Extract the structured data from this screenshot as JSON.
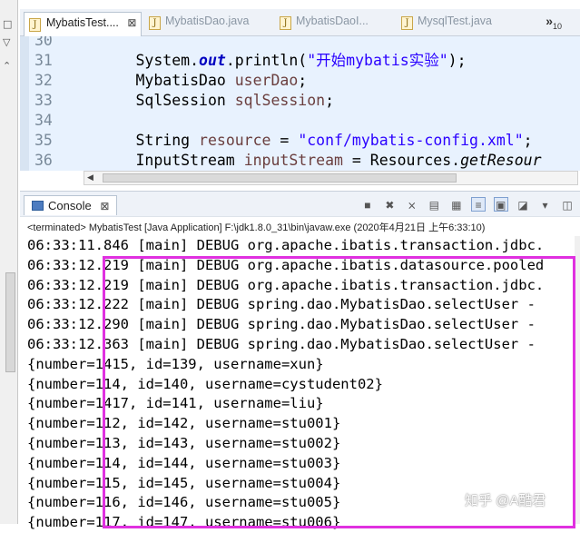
{
  "editor": {
    "tabs": [
      {
        "label": "MybatisTest....",
        "active": true
      },
      {
        "label": "MybatisDao.java",
        "active": false
      },
      {
        "label": "MybatisDaoI...",
        "active": false
      },
      {
        "label": "MysqlTest.java",
        "active": false
      }
    ],
    "tab_close": "⊠",
    "overflow_label": "»",
    "overflow_count": "10",
    "lines": [
      {
        "num": "30",
        "parts": []
      },
      {
        "num": "31",
        "parts": [
          {
            "t": "        System.",
            "c": ""
          },
          {
            "t": "out",
            "c": "fld"
          },
          {
            "t": ".println(",
            "c": ""
          },
          {
            "t": "\"开始mybatis实验\"",
            "c": "str"
          },
          {
            "t": ");",
            "c": ""
          }
        ]
      },
      {
        "num": "32",
        "parts": [
          {
            "t": "        MybatisDao ",
            "c": ""
          },
          {
            "t": "userDao",
            "c": "var"
          },
          {
            "t": ";",
            "c": ""
          }
        ]
      },
      {
        "num": "33",
        "parts": [
          {
            "t": "        SqlSession ",
            "c": ""
          },
          {
            "t": "sqlSession",
            "c": "var"
          },
          {
            "t": ";",
            "c": ""
          }
        ]
      },
      {
        "num": "34",
        "parts": []
      },
      {
        "num": "35",
        "parts": [
          {
            "t": "        String ",
            "c": ""
          },
          {
            "t": "resource",
            "c": "var"
          },
          {
            "t": " = ",
            "c": ""
          },
          {
            "t": "\"conf/mybatis-config.xml\"",
            "c": "str"
          },
          {
            "t": ";",
            "c": ""
          }
        ]
      },
      {
        "num": "36",
        "parts": [
          {
            "t": "        InputStream ",
            "c": ""
          },
          {
            "t": "inputStream",
            "c": "var"
          },
          {
            "t": " = Resources.",
            "c": ""
          },
          {
            "t": "getResour",
            "c": "mth"
          }
        ]
      }
    ]
  },
  "console": {
    "title": "Console",
    "close": "⊠",
    "status": "<terminated> MybatisTest [Java Application] F:\\jdk1.8.0_31\\bin\\javaw.exe (2020年4月21日 上午6:33:10)",
    "output": [
      "06:33:11.846 [main] DEBUG org.apache.ibatis.transaction.jdbc.",
      "06:33:12.219 [main] DEBUG org.apache.ibatis.datasource.pooled",
      "06:33:12.219 [main] DEBUG org.apache.ibatis.transaction.jdbc.",
      "06:33:12.222 [main] DEBUG spring.dao.MybatisDao.selectUser -",
      "06:33:12.290 [main] DEBUG spring.dao.MybatisDao.selectUser -",
      "06:33:12.363 [main] DEBUG spring.dao.MybatisDao.selectUser -",
      "{number=1415, id=139, username=xun}",
      "{number=114, id=140, username=cystudent02}",
      "{number=1417, id=141, username=liu}",
      "{number=112, id=142, username=stu001}",
      "{number=113, id=143, username=stu002}",
      "{number=114, id=144, username=stu003}",
      "{number=115, id=145, username=stu004}",
      "{number=116, id=146, username=stu005}",
      "{number=117, id=147, username=stu006}"
    ]
  },
  "watermark": "知乎 @A酷君",
  "colors": {
    "highlight_box": "#e030e0",
    "code_line_bg": "#e8f2fe"
  }
}
